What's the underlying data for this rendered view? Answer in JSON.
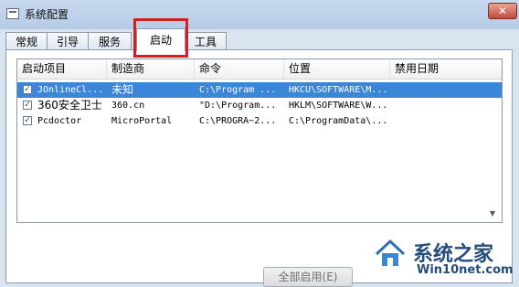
{
  "window": {
    "title": "系统配置",
    "close_label": "✕"
  },
  "tabs": [
    {
      "label": "常规"
    },
    {
      "label": "引导"
    },
    {
      "label": "服务"
    },
    {
      "label": "启动"
    },
    {
      "label": "工具"
    }
  ],
  "active_tab": "启动",
  "highlight_color": "#d21f1f",
  "columns": [
    "启动项目",
    "制造商",
    "命令",
    "位置",
    "禁用日期"
  ],
  "rows": [
    {
      "checked": true,
      "item": "JOnlineCl...",
      "maker": "未知",
      "command": "C:\\Program ...",
      "location": "HKCU\\SOFTWARE\\M...",
      "disabled_date": "",
      "selected": true
    },
    {
      "checked": true,
      "item": "360安全卫士",
      "maker": "360.cn",
      "command": "\"D:\\Program...",
      "location": "HKLM\\SOFTWARE\\W...",
      "disabled_date": ""
    },
    {
      "checked": true,
      "item": "Pcdoctor",
      "maker": "MicroPortal",
      "command": "C:\\PROGRA~2...",
      "location": "C:\\ProgramData\\...",
      "disabled_date": ""
    }
  ],
  "buttons": {
    "enable_all": "全部启用(E)"
  },
  "watermark": {
    "name": "系统之家",
    "url": "Win10net.com"
  }
}
